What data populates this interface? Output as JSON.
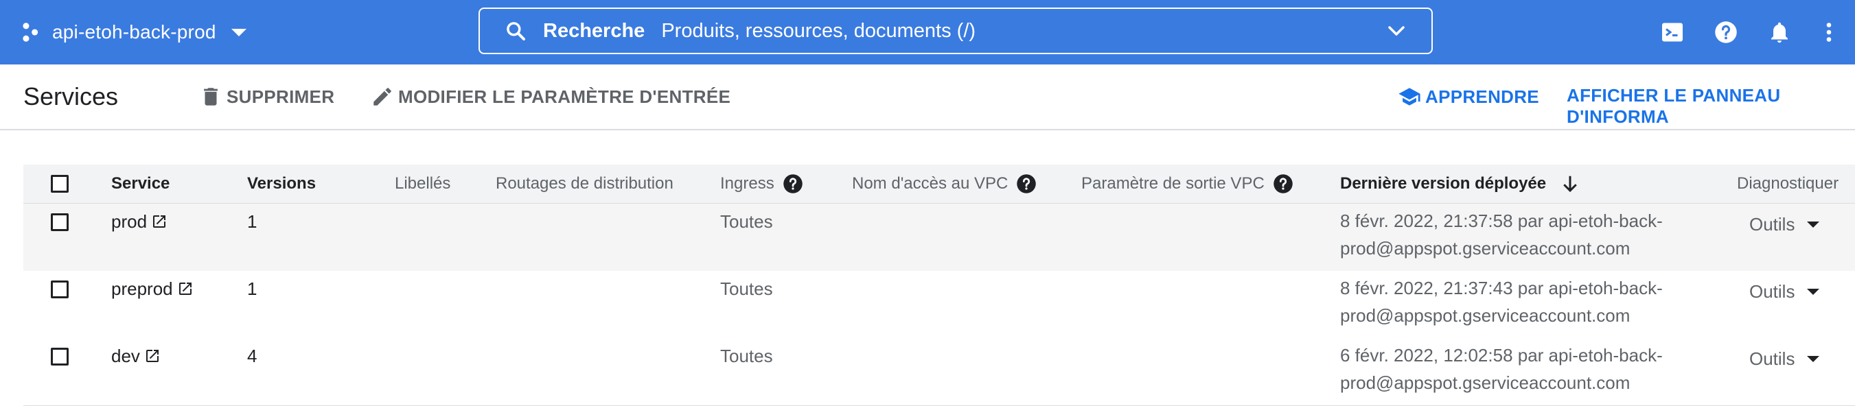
{
  "header": {
    "project_name": "api-etoh-back-prod",
    "search_label": "Recherche",
    "search_placeholder": "Produits, ressources, documents (/)",
    "icons": [
      "terminal-icon",
      "help-icon",
      "notifications-icon",
      "more-vert-icon"
    ]
  },
  "colors": {
    "topbar": "#3a7be0",
    "link_blue": "#1a73e8",
    "header_row": "#f1f3f4"
  },
  "actionbar": {
    "title": "Services",
    "delete_label": "SUPPRIMER",
    "modify_label": "MODIFIER LE PARAMÈTRE D'ENTRÉE",
    "learn_label": "APPRENDRE",
    "info_panel_label": "AFFICHER LE PANNEAU D'INFORMA"
  },
  "table": {
    "columns": {
      "service": "Service",
      "versions": "Versions",
      "labels": "Libellés",
      "routing": "Routages de distribution",
      "ingress": "Ingress",
      "vpc_access": "Nom d'accès au VPC",
      "vpc_egress": "Paramètre de sortie VPC",
      "last_deployed": "Dernière version déployée",
      "diagnose": "Diagnostiquer"
    },
    "rows": [
      {
        "service": "prod",
        "versions": "1",
        "ingress": "Toutes",
        "deployed_line1": "8 févr. 2022, 21:37:58 par api-etoh-back-",
        "deployed_line2": "prod@appspot.gserviceaccount.com",
        "tools": "Outils"
      },
      {
        "service": "preprod",
        "versions": "1",
        "ingress": "Toutes",
        "deployed_line1": "8 févr. 2022, 21:37:43 par api-etoh-back-",
        "deployed_line2": "prod@appspot.gserviceaccount.com",
        "tools": "Outils"
      },
      {
        "service": "dev",
        "versions": "4",
        "ingress": "Toutes",
        "deployed_line1": "6 févr. 2022, 12:02:58 par api-etoh-back-",
        "deployed_line2": "prod@appspot.gserviceaccount.com",
        "tools": "Outils"
      }
    ]
  }
}
